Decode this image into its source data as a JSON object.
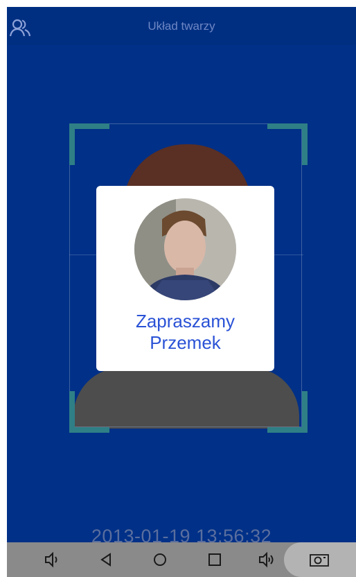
{
  "header": {
    "title": "Układ twarzy",
    "users_icon": "users-icon"
  },
  "dialog": {
    "greeting": "Zapraszamy",
    "name": "Przemek",
    "avatar_icon": "user-photo"
  },
  "datetime": "2013-01-19 13:56:32",
  "navbar": {
    "buttons": [
      "volume-down-icon",
      "back-icon",
      "home-icon",
      "recents-icon",
      "volume-up-icon",
      "camera-icon"
    ]
  },
  "colors": {
    "background": "#003087",
    "accent": "#2a52d6",
    "frame_corner": "#2f7f86"
  }
}
